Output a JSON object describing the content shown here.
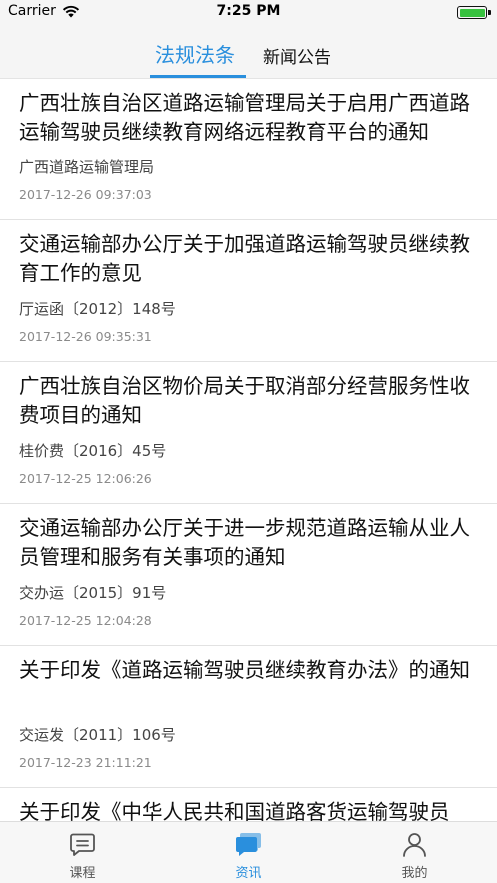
{
  "status_bar": {
    "carrier": "Carrier",
    "time": "7:25 PM"
  },
  "tabs": [
    {
      "label": "法规法条",
      "active": true
    },
    {
      "label": "新闻公告",
      "active": false
    }
  ],
  "items": [
    {
      "title": "广西壮族自治区道路运输管理局关于启用广西道路运输驾驶员继续教育网络远程教育平台的通知",
      "source": "广西道路运输管理局",
      "date": "2017-12-26 09:37:03"
    },
    {
      "title": "交通运输部办公厅关于加强道路运输驾驶员继续教育工作的意见",
      "source": "厅运函〔2012〕148号",
      "date": "2017-12-26 09:35:31"
    },
    {
      "title": "广西壮族自治区物价局关于取消部分经营服务性收费项目的通知",
      "source": "桂价费〔2016〕45号",
      "date": "2017-12-25 12:06:26"
    },
    {
      "title": "交通运输部办公厅关于进一步规范道路运输从业人员管理和服务有关事项的通知",
      "source": "交办运〔2015〕91号",
      "date": "2017-12-25 12:04:28"
    },
    {
      "title": "关于印发《道路运输驾驶员继续教育办法》的通知",
      "source": "交运发〔2011〕106号",
      "date": "2017-12-23 21:11:21"
    },
    {
      "title": "关于印发《中华人民共和国道路客货运输驾驶员"
    }
  ],
  "bottom_nav": [
    {
      "label": "课程",
      "icon": "chat-list-icon",
      "active": false
    },
    {
      "label": "资讯",
      "icon": "chat-bubbles-icon",
      "active": true
    },
    {
      "label": "我的",
      "icon": "person-icon",
      "active": false
    }
  ],
  "colors": {
    "accent": "#2a8fdd",
    "battery": "#37c23f"
  }
}
